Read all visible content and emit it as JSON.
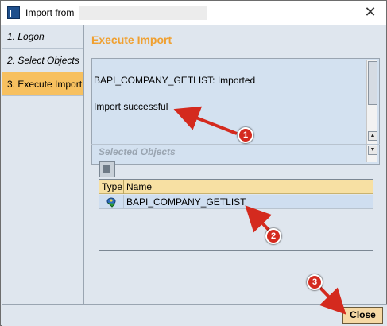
{
  "window": {
    "title": "Import from",
    "close_glyph": "✕"
  },
  "nav": {
    "items": [
      {
        "label": "1. Logon"
      },
      {
        "label": "2. Select Objects"
      },
      {
        "label": "3. Execute Import"
      }
    ]
  },
  "main": {
    "section_title": "Execute Import",
    "log": {
      "line1": "BAPI_COMPANY_GETLIST: Imported",
      "line2": "Import successful"
    },
    "selected_objects": {
      "title": "Selected Objects",
      "columns": [
        "Type",
        "Name"
      ],
      "rows": [
        {
          "name": "BAPI_COMPANY_GETLIST",
          "type_icon": "bapi-object-icon"
        }
      ]
    }
  },
  "footer": {
    "close_label": "Close"
  },
  "annotations": {
    "badges": [
      "1",
      "2",
      "3"
    ],
    "color": "#d42a1e"
  },
  "colors": {
    "accent": "#f0a030",
    "active_nav": "#f7c05f",
    "header_bg": "#f7e0a3",
    "close_button": "#f6d9a5"
  }
}
